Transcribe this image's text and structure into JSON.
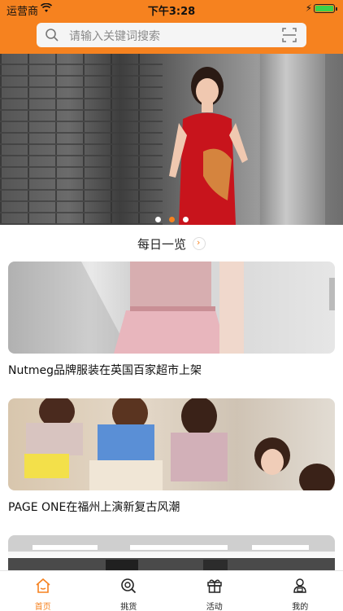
{
  "status_bar": {
    "carrier": "运营商",
    "time": "下午3:28"
  },
  "search": {
    "placeholder": "请输入关键词搜索",
    "search_icon": "search-icon",
    "scan_icon": "scan-icon"
  },
  "banner": {
    "dot_count": 3,
    "active_dot": 1
  },
  "daily": {
    "title": "每日一览",
    "arrow": "›"
  },
  "articles": [
    {
      "title": "Nutmeg品牌服装在英国百家超市上架"
    },
    {
      "title": "PAGE ONE在福州上演新复古风潮"
    },
    {
      "title": ""
    }
  ],
  "tabbar": {
    "items": [
      {
        "label": "首页",
        "icon": "home-icon",
        "active": true
      },
      {
        "label": "挑货",
        "icon": "search-goods-icon",
        "active": false
      },
      {
        "label": "活动",
        "icon": "gift-icon",
        "active": false
      },
      {
        "label": "我的",
        "icon": "user-icon",
        "active": false
      }
    ]
  },
  "colors": {
    "accent": "#f6821f",
    "tab_inactive": "#222222"
  }
}
